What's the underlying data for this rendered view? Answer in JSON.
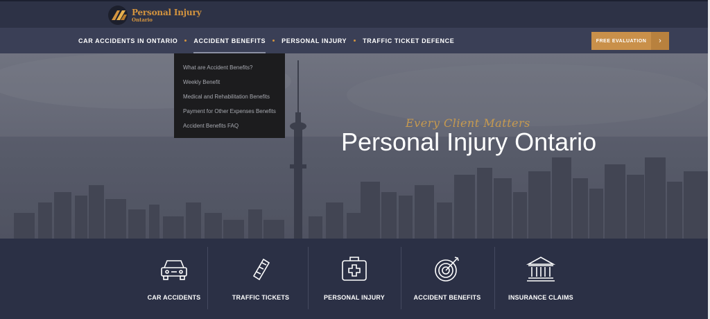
{
  "logo": {
    "title": "Personal Injury",
    "subtitle": "Ontario"
  },
  "nav": {
    "items": [
      {
        "label": "CAR ACCIDENTS IN ONTARIO"
      },
      {
        "label": "ACCIDENT BENEFITS"
      },
      {
        "label": "PERSONAL INJURY"
      },
      {
        "label": "TRAFFIC TICKET DEFENCE"
      }
    ],
    "cta_label": "FREE EVALUATION",
    "cta_arrow": "›"
  },
  "dropdown": {
    "items": [
      "What are Accident Benefits?",
      "Weekly Benefit",
      "Medical and Rehabilitation Benefits",
      "Payment for Other Expenses Benefits",
      "Accident Benefits FAQ"
    ]
  },
  "hero": {
    "tagline": "Every Client Matters",
    "title": "Personal Injury Ontario"
  },
  "services": [
    {
      "label": "CAR ACCIDENTS",
      "icon": "car-icon"
    },
    {
      "label": "TRAFFIC TICKETS",
      "icon": "ticket-icon"
    },
    {
      "label": "PERSONAL INJURY",
      "icon": "first-aid-kit-icon"
    },
    {
      "label": "ACCIDENT BENEFITS",
      "icon": "target-icon"
    },
    {
      "label": "INSURANCE CLAIMS",
      "icon": "bank-icon"
    }
  ],
  "colors": {
    "accent": "#d3943f",
    "nav_bg": "#3a3f56",
    "footer_bg": "#2b3045",
    "cta": "#c9904a"
  }
}
